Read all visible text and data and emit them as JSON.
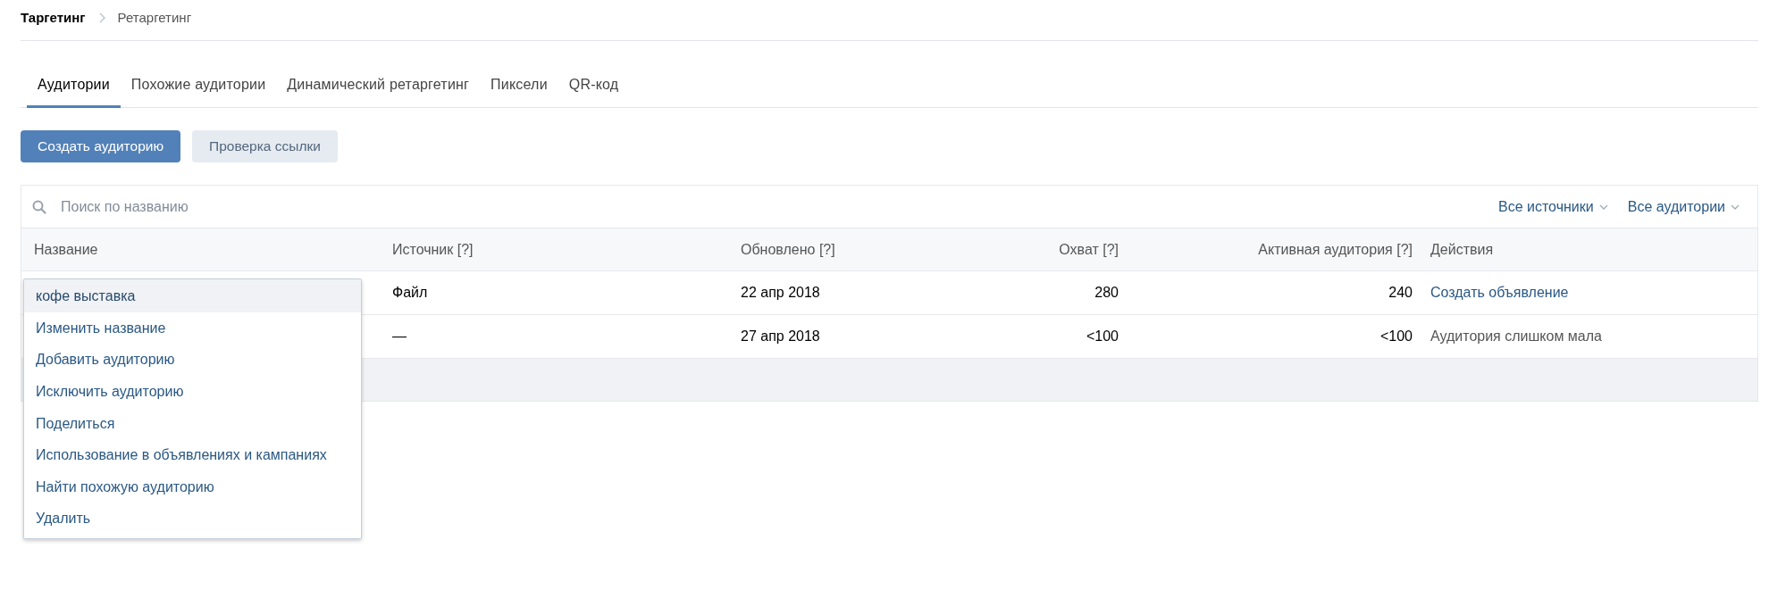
{
  "breadcrumb": [
    "Таргетинг",
    "Ретаргетинг"
  ],
  "tabs": [
    {
      "label": "Аудитории",
      "selected": true
    },
    {
      "label": "Похожие аудитории",
      "selected": false
    },
    {
      "label": "Динамический ретаргетинг",
      "selected": false
    },
    {
      "label": "Пиксели",
      "selected": false
    },
    {
      "label": "QR-код",
      "selected": false
    }
  ],
  "buttons": [
    {
      "label": "Создать аудиторию",
      "kind": "primary"
    },
    {
      "label": "Проверка ссылки",
      "kind": "secondary"
    }
  ],
  "search": {
    "placeholder": "Поиск по названию"
  },
  "filters": [
    "Все источники",
    "Все аудитории"
  ],
  "table": {
    "columns": [
      "Название",
      "Источник [?]",
      "Обновлено [?]",
      "Охват [?]",
      "Активная аудитория [?]",
      "Действия"
    ],
    "rows": [
      {
        "source": "Файл",
        "updated": "22 апр 2018",
        "reach": "280",
        "active": "240",
        "action": {
          "text": "Создать объявление",
          "kind": "link"
        }
      },
      {
        "source": "—",
        "updated": "27 апр 2018",
        "reach": "<100",
        "active": "<100",
        "action": {
          "text": "Аудитория слишком мала",
          "kind": "text"
        }
      }
    ]
  },
  "context_menu": {
    "title": "кофе выставка",
    "items": [
      "Изменить название",
      "Добавить аудиторию",
      "Исключить аудиторию",
      "Поделиться",
      "Использование в объявлениях и кампаниях",
      "Найти похожую аудиторию",
      "Удалить"
    ]
  }
}
